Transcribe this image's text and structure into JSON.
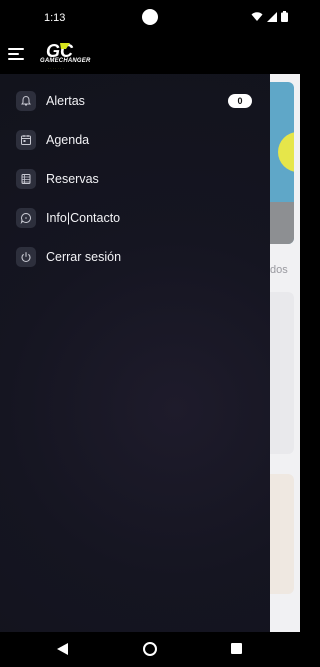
{
  "status": {
    "time": "1:13",
    "icons": [
      "wifi-icon",
      "signal-icon",
      "battery-icon"
    ]
  },
  "header": {
    "logo_mark": "GC",
    "brand_name": "GAMECHANGER",
    "brand_tagline": "· · · · · · ·"
  },
  "drawer": {
    "items": [
      {
        "label": "Alertas",
        "icon": "bell-icon",
        "badge": "0"
      },
      {
        "label": "Agenda",
        "icon": "calendar-icon"
      },
      {
        "label": "Reservas",
        "icon": "booking-icon"
      },
      {
        "label": "Info|Contacto",
        "icon": "chat-icon"
      },
      {
        "label": "Cerrar sesión",
        "icon": "power-icon"
      }
    ]
  },
  "background": {
    "partial_text": "dos"
  },
  "colors": {
    "drawer_bg": "#151521",
    "icon_box": "#2d2f3c",
    "brand_accent": "#d8e61c"
  }
}
